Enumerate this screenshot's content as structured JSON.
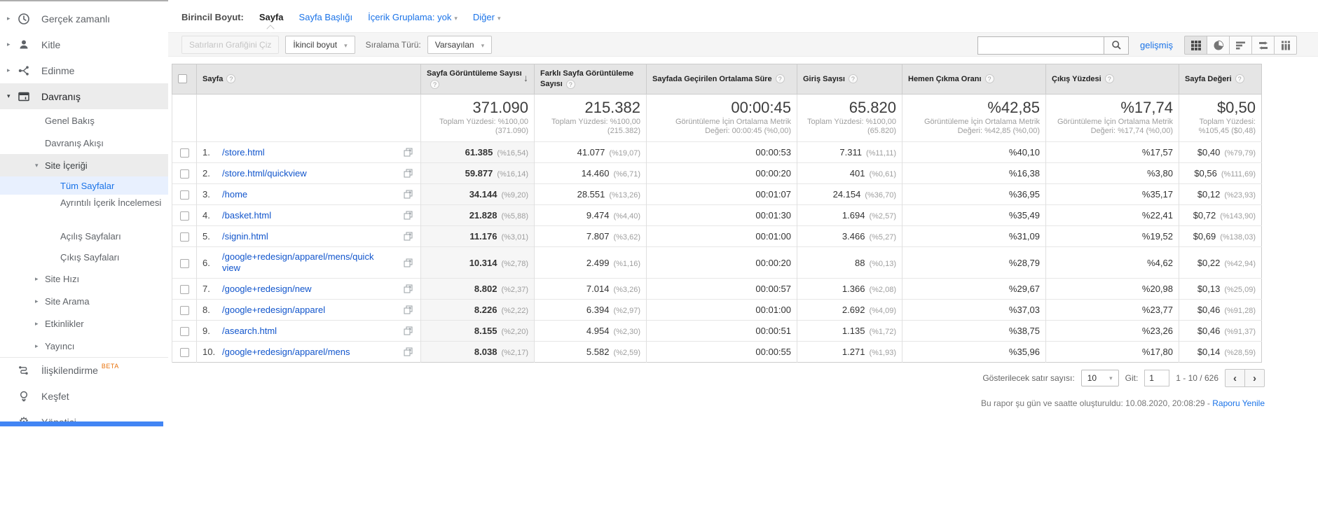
{
  "colors": {
    "link_blue": "#1155cc",
    "accent_blue": "#1a73e8",
    "selected_bg": "#e8f0fe",
    "beta_orange": "#e8710a",
    "header_gray": "#e5e5e5"
  },
  "sidebar": {
    "realtime": "Gerçek zamanlı",
    "audience": "Kitle",
    "acquisition": "Edinme",
    "behavior": "Davranış",
    "behavior_overview": "Genel Bakış",
    "behavior_flow": "Davranış Akışı",
    "site_content": "Site İçeriği",
    "all_pages": "Tüm Sayfalar",
    "content_drilldown": "Ayrıntılı İçerik İncelemesi",
    "landing_pages": "Açılış Sayfaları",
    "exit_pages": "Çıkış Sayfaları",
    "site_speed": "Site Hızı",
    "site_search": "Site Arama",
    "events": "Etkinlikler",
    "publisher": "Yayıncı",
    "attribution": "İlişkilendirme",
    "attribution_badge": "BETA",
    "discover": "Keşfet",
    "admin": "Yönetici"
  },
  "toolbar": {
    "primary_dimension_label": "Birincil Boyut:",
    "dim_page": "Sayfa",
    "dim_page_title": "Sayfa Başlığı",
    "dim_content_grouping": "İçerik Gruplama: yok",
    "dim_other": "Diğer",
    "plot_rows": "Satırların Grafiğini Çiz",
    "secondary_dimension": "İkincil boyut",
    "sort_type_label": "Sıralama Türü:",
    "sort_default": "Varsayılan",
    "advanced": "gelişmiş"
  },
  "table": {
    "columns": [
      "Sayfa",
      "Sayfa Görüntüleme Sayısı",
      "Farklı Sayfa Görüntüleme Sayısı",
      "Sayfada Geçirilen Ortalama Süre",
      "Giriş Sayısı",
      "Hemen Çıkma Oranı",
      "Çıkış Yüzdesi",
      "Sayfa Değeri"
    ],
    "summary": {
      "pageviews": "371.090",
      "pageviews_sub": "Toplam Yüzdesi: %100,00 (371.090)",
      "unique_pageviews": "215.382",
      "unique_pageviews_sub": "Toplam Yüzdesi: %100,00 (215.382)",
      "avg_time": "00:00:45",
      "avg_time_sub": "Görüntüleme İçin Ortalama Metrik Değeri: 00:00:45 (%0,00)",
      "entrances": "65.820",
      "entrances_sub": "Toplam Yüzdesi: %100,00 (65.820)",
      "bounce_rate": "%42,85",
      "bounce_rate_sub": "Görüntüleme İçin Ortalama Metrik Değeri: %42,85 (%0,00)",
      "exit_pct": "%17,74",
      "exit_pct_sub": "Görüntüleme İçin Ortalama Metrik Değeri: %17,74 (%0,00)",
      "page_value": "$0,50",
      "page_value_sub": "Toplam Yüzdesi: %105,45 ($0,48)"
    },
    "rows": [
      {
        "idx": "1.",
        "page": "/store.html",
        "pv": "61.385",
        "pv_pct": "(%16,54)",
        "upv": "41.077",
        "upv_pct": "(%19,07)",
        "time": "00:00:53",
        "ent": "7.311",
        "ent_pct": "(%11,11)",
        "bounce": "%40,10",
        "exit": "%17,57",
        "val": "$0,40",
        "val_pct": "(%79,79)"
      },
      {
        "idx": "2.",
        "page": "/store.html/quickview",
        "pv": "59.877",
        "pv_pct": "(%16,14)",
        "upv": "14.460",
        "upv_pct": "(%6,71)",
        "time": "00:00:20",
        "ent": "401",
        "ent_pct": "(%0,61)",
        "bounce": "%16,38",
        "exit": "%3,80",
        "val": "$0,56",
        "val_pct": "(%111,69)"
      },
      {
        "idx": "3.",
        "page": "/home",
        "pv": "34.144",
        "pv_pct": "(%9,20)",
        "upv": "28.551",
        "upv_pct": "(%13,26)",
        "time": "00:01:07",
        "ent": "24.154",
        "ent_pct": "(%36,70)",
        "bounce": "%36,95",
        "exit": "%35,17",
        "val": "$0,12",
        "val_pct": "(%23,93)"
      },
      {
        "idx": "4.",
        "page": "/basket.html",
        "pv": "21.828",
        "pv_pct": "(%5,88)",
        "upv": "9.474",
        "upv_pct": "(%4,40)",
        "time": "00:01:30",
        "ent": "1.694",
        "ent_pct": "(%2,57)",
        "bounce": "%35,49",
        "exit": "%22,41",
        "val": "$0,72",
        "val_pct": "(%143,90)"
      },
      {
        "idx": "5.",
        "page": "/signin.html",
        "pv": "11.176",
        "pv_pct": "(%3,01)",
        "upv": "7.807",
        "upv_pct": "(%3,62)",
        "time": "00:01:00",
        "ent": "3.466",
        "ent_pct": "(%5,27)",
        "bounce": "%31,09",
        "exit": "%19,52",
        "val": "$0,69",
        "val_pct": "(%138,03)"
      },
      {
        "idx": "6.",
        "page": "/google+redesign/apparel/mens/quickview",
        "pv": "10.314",
        "pv_pct": "(%2,78)",
        "upv": "2.499",
        "upv_pct": "(%1,16)",
        "time": "00:00:20",
        "ent": "88",
        "ent_pct": "(%0,13)",
        "bounce": "%28,79",
        "exit": "%4,62",
        "val": "$0,22",
        "val_pct": "(%42,94)"
      },
      {
        "idx": "7.",
        "page": "/google+redesign/new",
        "pv": "8.802",
        "pv_pct": "(%2,37)",
        "upv": "7.014",
        "upv_pct": "(%3,26)",
        "time": "00:00:57",
        "ent": "1.366",
        "ent_pct": "(%2,08)",
        "bounce": "%29,67",
        "exit": "%20,98",
        "val": "$0,13",
        "val_pct": "(%25,09)"
      },
      {
        "idx": "8.",
        "page": "/google+redesign/apparel",
        "pv": "8.226",
        "pv_pct": "(%2,22)",
        "upv": "6.394",
        "upv_pct": "(%2,97)",
        "time": "00:01:00",
        "ent": "2.692",
        "ent_pct": "(%4,09)",
        "bounce": "%37,03",
        "exit": "%23,77",
        "val": "$0,46",
        "val_pct": "(%91,28)"
      },
      {
        "idx": "9.",
        "page": "/asearch.html",
        "pv": "8.155",
        "pv_pct": "(%2,20)",
        "upv": "4.954",
        "upv_pct": "(%2,30)",
        "time": "00:00:51",
        "ent": "1.135",
        "ent_pct": "(%1,72)",
        "bounce": "%38,75",
        "exit": "%23,26",
        "val": "$0,46",
        "val_pct": "(%91,37)"
      },
      {
        "idx": "10.",
        "page": "/google+redesign/apparel/mens",
        "pv": "8.038",
        "pv_pct": "(%2,17)",
        "upv": "5.582",
        "upv_pct": "(%2,59)",
        "time": "00:00:55",
        "ent": "1.271",
        "ent_pct": "(%1,93)",
        "bounce": "%35,96",
        "exit": "%17,80",
        "val": "$0,14",
        "val_pct": "(%28,59)"
      }
    ]
  },
  "footer": {
    "rows_label": "Gösterilecek satır sayısı:",
    "rows_value": "10",
    "goto_label": "Git:",
    "goto_value": "1",
    "range": "1 - 10 / 626",
    "generated": "Bu rapor şu gün ve saatte oluşturuldu: 10.08.2020, 20:08:29 -",
    "refresh": "Raporu Yenile"
  }
}
